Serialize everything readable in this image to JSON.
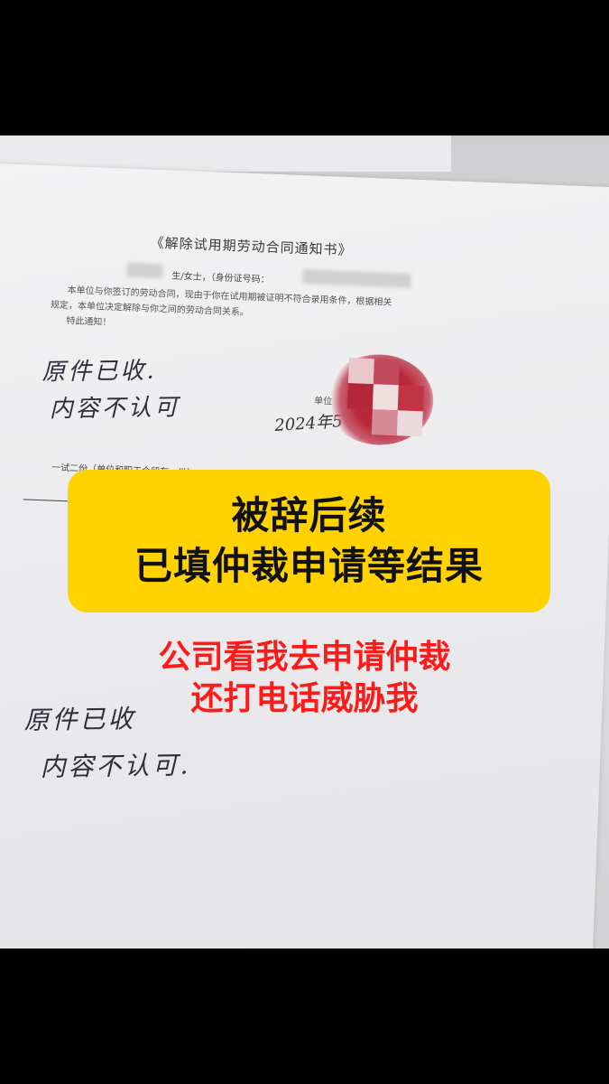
{
  "document": {
    "title": "《解除试用期劳动合同通知书》",
    "salutation": "生/女士，（身份证号码：",
    "body_line1": "本单位与你签订的劳动合同，现由于你在试用期被证明不符合录用条件，根据相关",
    "body_line2": "规定，本单位决定解除与你之间的劳动合同关系。",
    "body_line3": "特此通知！",
    "unit_label": "单位",
    "date_handwritten": "2024年5",
    "copies_note": "一试二份（单位和职工个留存一份）",
    "handwriting_line1": "原件已收.",
    "handwriting_line2": "内容不认可",
    "handwriting_lower1": "原件已收",
    "handwriting_lower2": "内容不认可.",
    "stamp_color": "#b8283a"
  },
  "banner": {
    "line1": "被辞后续",
    "line2": "已填仲裁申请等结果",
    "background": "#ffd200"
  },
  "caption": {
    "line1": "公司看我去申请仲裁",
    "line2": "还打电话威胁我",
    "color": "#ff1a1a"
  }
}
